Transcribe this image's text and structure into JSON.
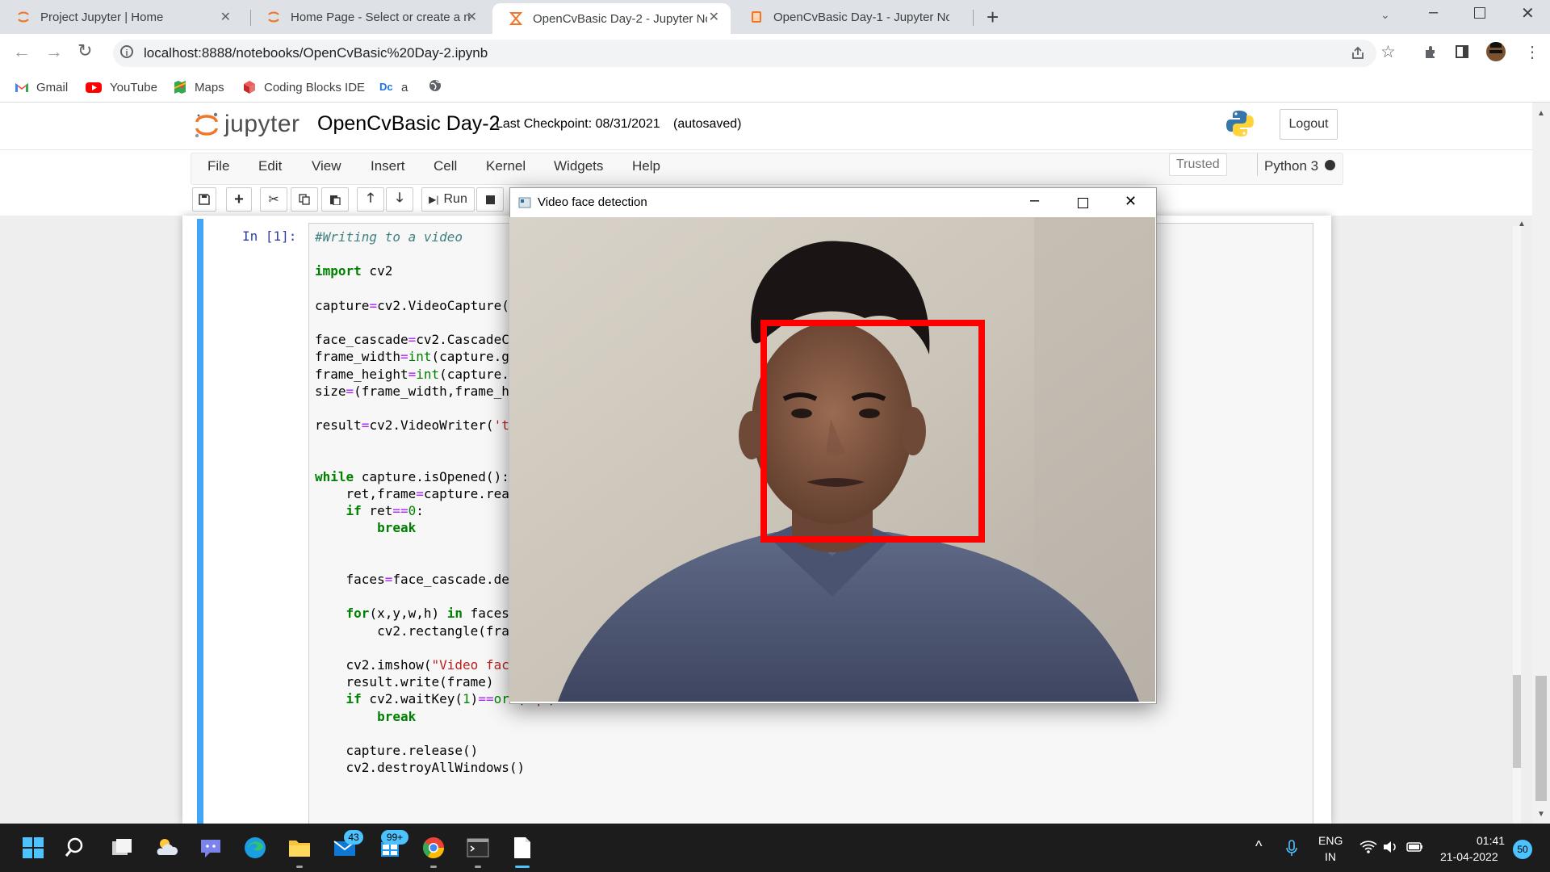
{
  "browser": {
    "tabs": [
      {
        "title": "Project Jupyter | Home",
        "active": false
      },
      {
        "title": "Home Page - Select or create a n",
        "active": false
      },
      {
        "title": "OpenCvBasic Day-2 - Jupyter No",
        "active": true
      },
      {
        "title": "OpenCvBasic Day-1 - Jupyter No",
        "active": false
      }
    ],
    "new_tab_label": "+",
    "url": "localhost:8888/notebooks/OpenCvBasic%20Day-2.ipynb",
    "bookmarks": [
      {
        "label": "Gmail",
        "icon": "gmail-icon"
      },
      {
        "label": "YouTube",
        "icon": "youtube-icon"
      },
      {
        "label": "Maps",
        "icon": "maps-icon"
      },
      {
        "label": "Coding Blocks IDE",
        "icon": "coding-blocks-icon"
      },
      {
        "label": "a",
        "icon": "dc-icon"
      }
    ]
  },
  "jupyter": {
    "logo_text": "jupyter",
    "notebook_name": "OpenCvBasic Day-2",
    "checkpoint": "Last Checkpoint: 08/31/2021",
    "autosaved": "(autosaved)",
    "logout": "Logout",
    "menu": [
      "File",
      "Edit",
      "View",
      "Insert",
      "Cell",
      "Kernel",
      "Widgets",
      "Help"
    ],
    "trusted": "Trusted",
    "kernel": "Python 3",
    "run_label": "Run",
    "prompt": "In [1]:"
  },
  "code_lines": [
    "#Writing to a video",
    "",
    "import cv2",
    "",
    "capture=cv2.VideoCapture(",
    "",
    "face_cascade=cv2.CascadeC",
    "frame_width=int(capture.g",
    "frame_height=int(capture.",
    "size=(frame_width,frame_h",
    "",
    "result=cv2.VideoWriter('t",
    "",
    "",
    "while capture.isOpened():",
    "    ret,frame=capture.rea",
    "    if ret==0:",
    "        break",
    "",
    "",
    "    faces=face_cascade.de",
    "",
    "    for(x,y,w,h) in faces",
    "        cv2.rectangle(fra",
    "",
    "    cv2.imshow(\"Video fac",
    "    result.write(frame)",
    "    if cv2.waitKey(1)==ord('q'):",
    "        break",
    "",
    "    capture.release()",
    "    cv2.destroyAllWindows()"
  ],
  "popup": {
    "title": "Video face detection",
    "detection_color": "#ff0000"
  },
  "taskbar": {
    "mail_badge": "43",
    "app_badge": "99+",
    "language": "ENG",
    "region": "IN",
    "time": "01:41",
    "date": "21-04-2022",
    "notifications": "50"
  }
}
